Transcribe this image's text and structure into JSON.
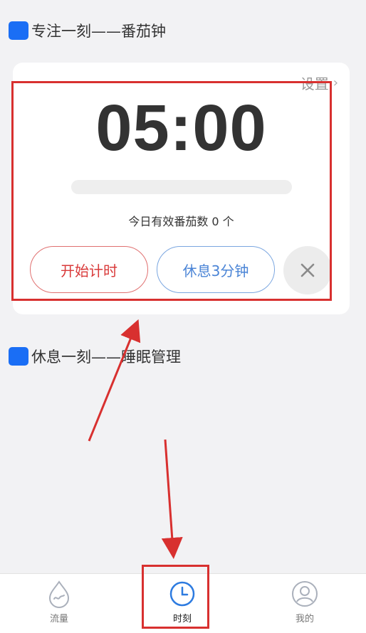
{
  "sections": {
    "focus_title": "专注一刻——番茄钟",
    "rest_title": "休息一刻——睡眠管理"
  },
  "timer": {
    "settings_label": "设置",
    "time": "05:00",
    "progress": 0,
    "count_text": "今日有效番茄数 0 个"
  },
  "buttons": {
    "start_label": "开始计时",
    "rest_label": "休息3分钟",
    "close_icon": "close-icon"
  },
  "tabbar": {
    "items": [
      {
        "label": "流量",
        "icon": "flow-icon"
      },
      {
        "label": "时刻",
        "icon": "clock-icon"
      },
      {
        "label": "我的",
        "icon": "user-icon"
      }
    ]
  },
  "colors": {
    "accent_blue": "#1a6ef5",
    "start_red": "#d93a3a",
    "rest_blue": "#4a84d6",
    "annotation_red": "#d8302f"
  }
}
